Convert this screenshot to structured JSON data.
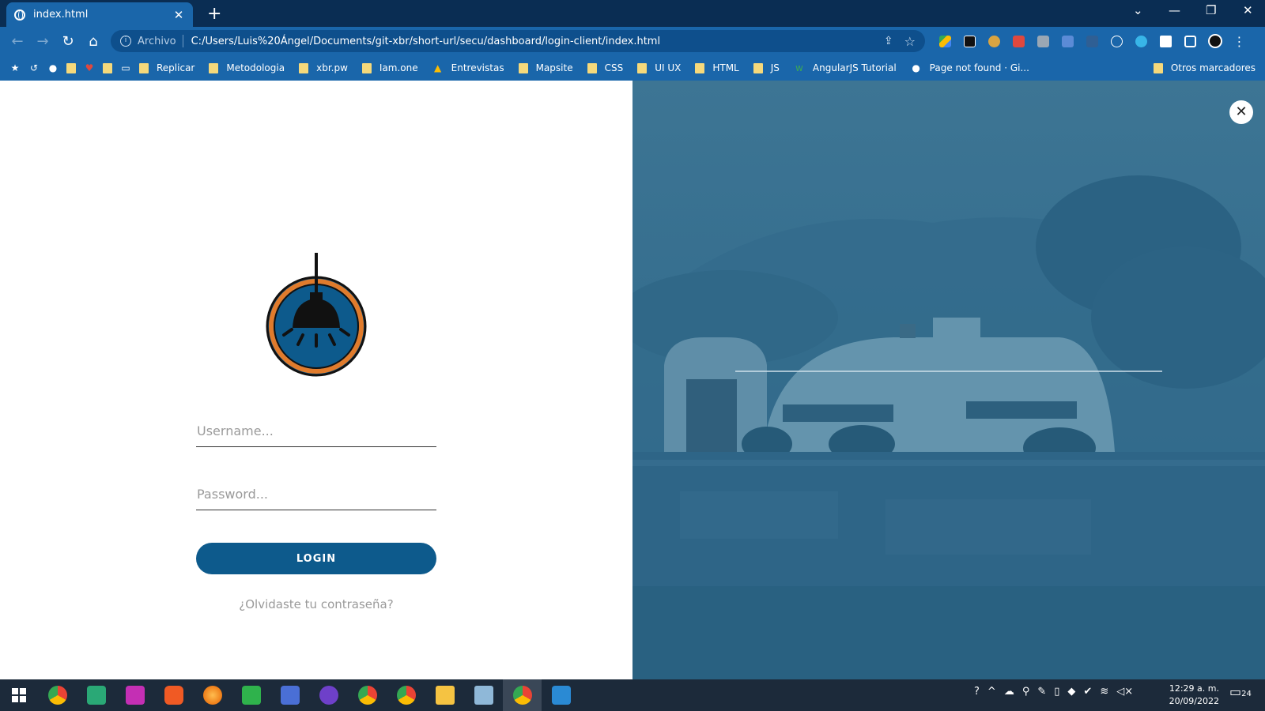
{
  "browser": {
    "tab_title": "index.html",
    "tab_close": "✕",
    "new_tab": "+",
    "address_scheme": "Archivo",
    "address_url": "C:/Users/Luis%20Ángel/Documents/git-xbr/short-url/secu/dashboard/login-client/index.html",
    "bookmarks": [
      "Replicar",
      "Metodologia",
      "xbr.pw",
      "Iam.one",
      "Entrevistas",
      "Mapsite",
      "CSS",
      "UI UX",
      "HTML",
      "JS",
      "AngularJS Tutorial",
      "Page not found · Gi..."
    ],
    "other_bookmarks": "Otros marcadores"
  },
  "login": {
    "username_placeholder": "Username...",
    "password_placeholder": "Password...",
    "login_label": "LOGIN",
    "forgot_label": "¿Olvidaste tu contraseña?"
  },
  "panel": {
    "close_label": "✕"
  },
  "taskbar": {
    "time": "12:29 a. m.",
    "date": "20/09/2022",
    "notifications": "24"
  },
  "colors": {
    "chrome_dark": "#0a2d53",
    "chrome": "#1a66aa",
    "button": "#0d5a8c",
    "overlay": "#2d6a8c"
  }
}
